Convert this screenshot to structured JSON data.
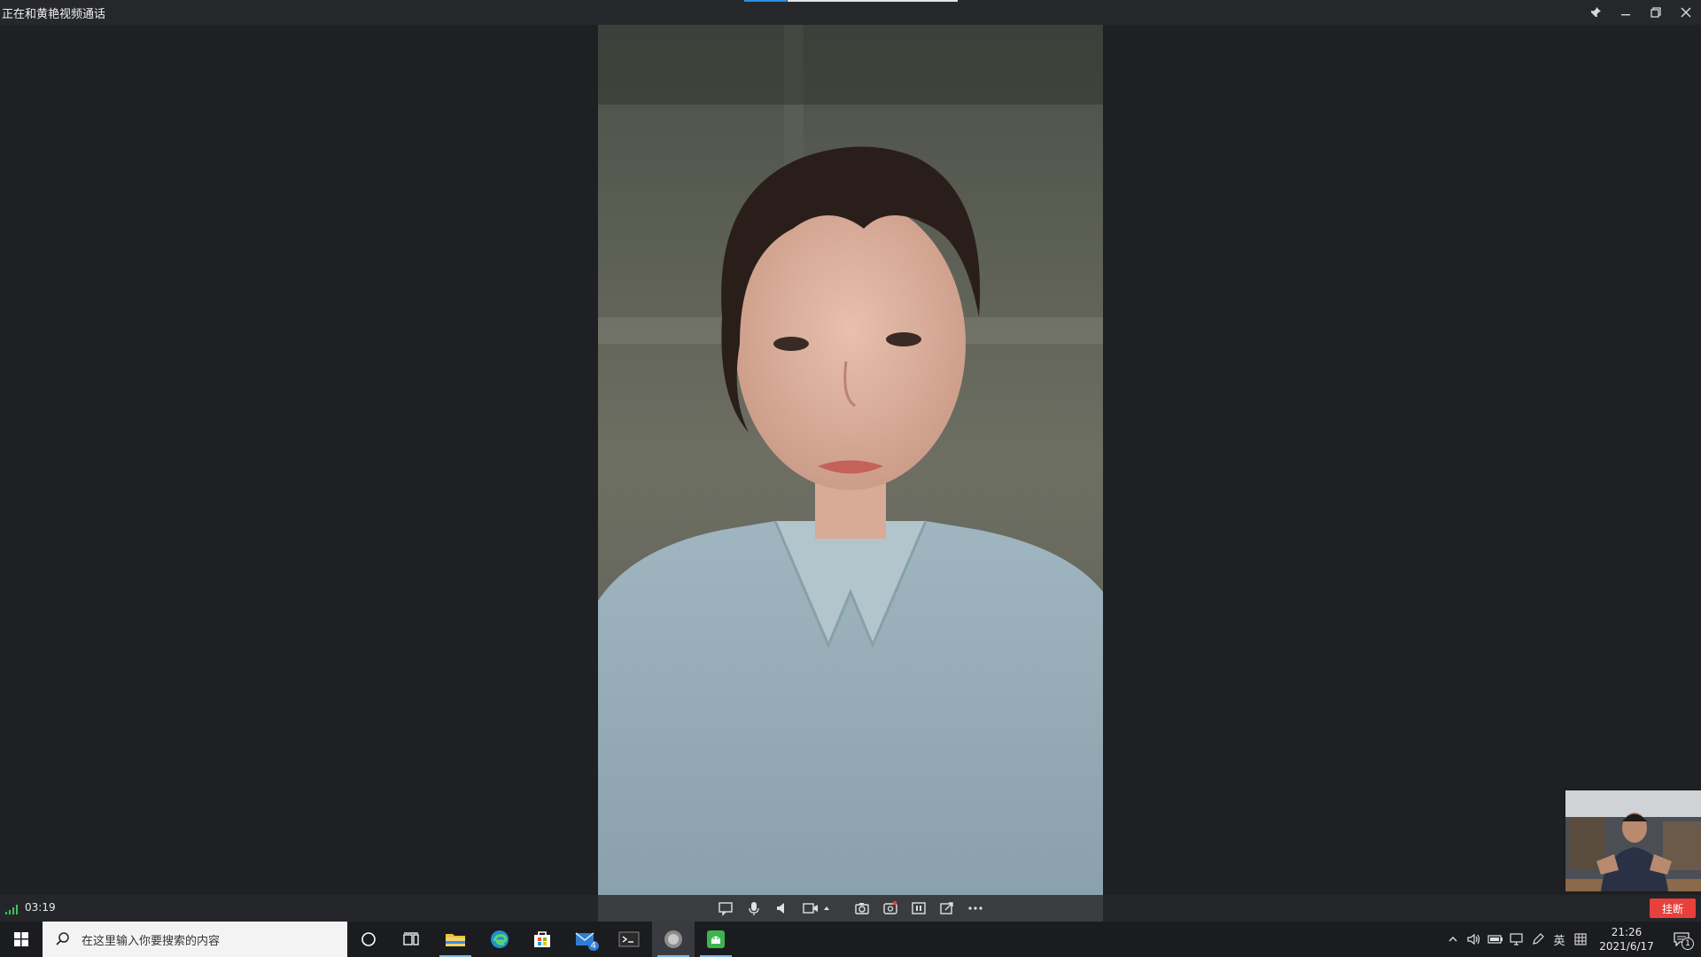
{
  "window": {
    "title": "正在和黄艳视频通话",
    "call_progress": 0.2
  },
  "call": {
    "duration": "03:19",
    "hangup_label": "挂断",
    "toolbar": [
      {
        "icon": "chat-icon"
      },
      {
        "icon": "microphone-icon"
      },
      {
        "icon": "speaker-icon"
      },
      {
        "icon": "camera-icon"
      },
      {
        "icon": "caret-up-icon"
      },
      {
        "icon": "screenshot-icon"
      },
      {
        "icon": "record-icon"
      },
      {
        "icon": "layout-icon"
      },
      {
        "icon": "share-screen-icon"
      },
      {
        "icon": "more-icon"
      }
    ]
  },
  "taskbar": {
    "search_placeholder": "在这里输入你要搜索的内容",
    "mail_badge": "4",
    "ime_label": "英",
    "time": "21:26",
    "date": "2021/6/17",
    "notification_count": "1"
  },
  "colors": {
    "hangup": "#e8403b",
    "accent": "#2e8be6",
    "signal": "#3fc45c"
  }
}
